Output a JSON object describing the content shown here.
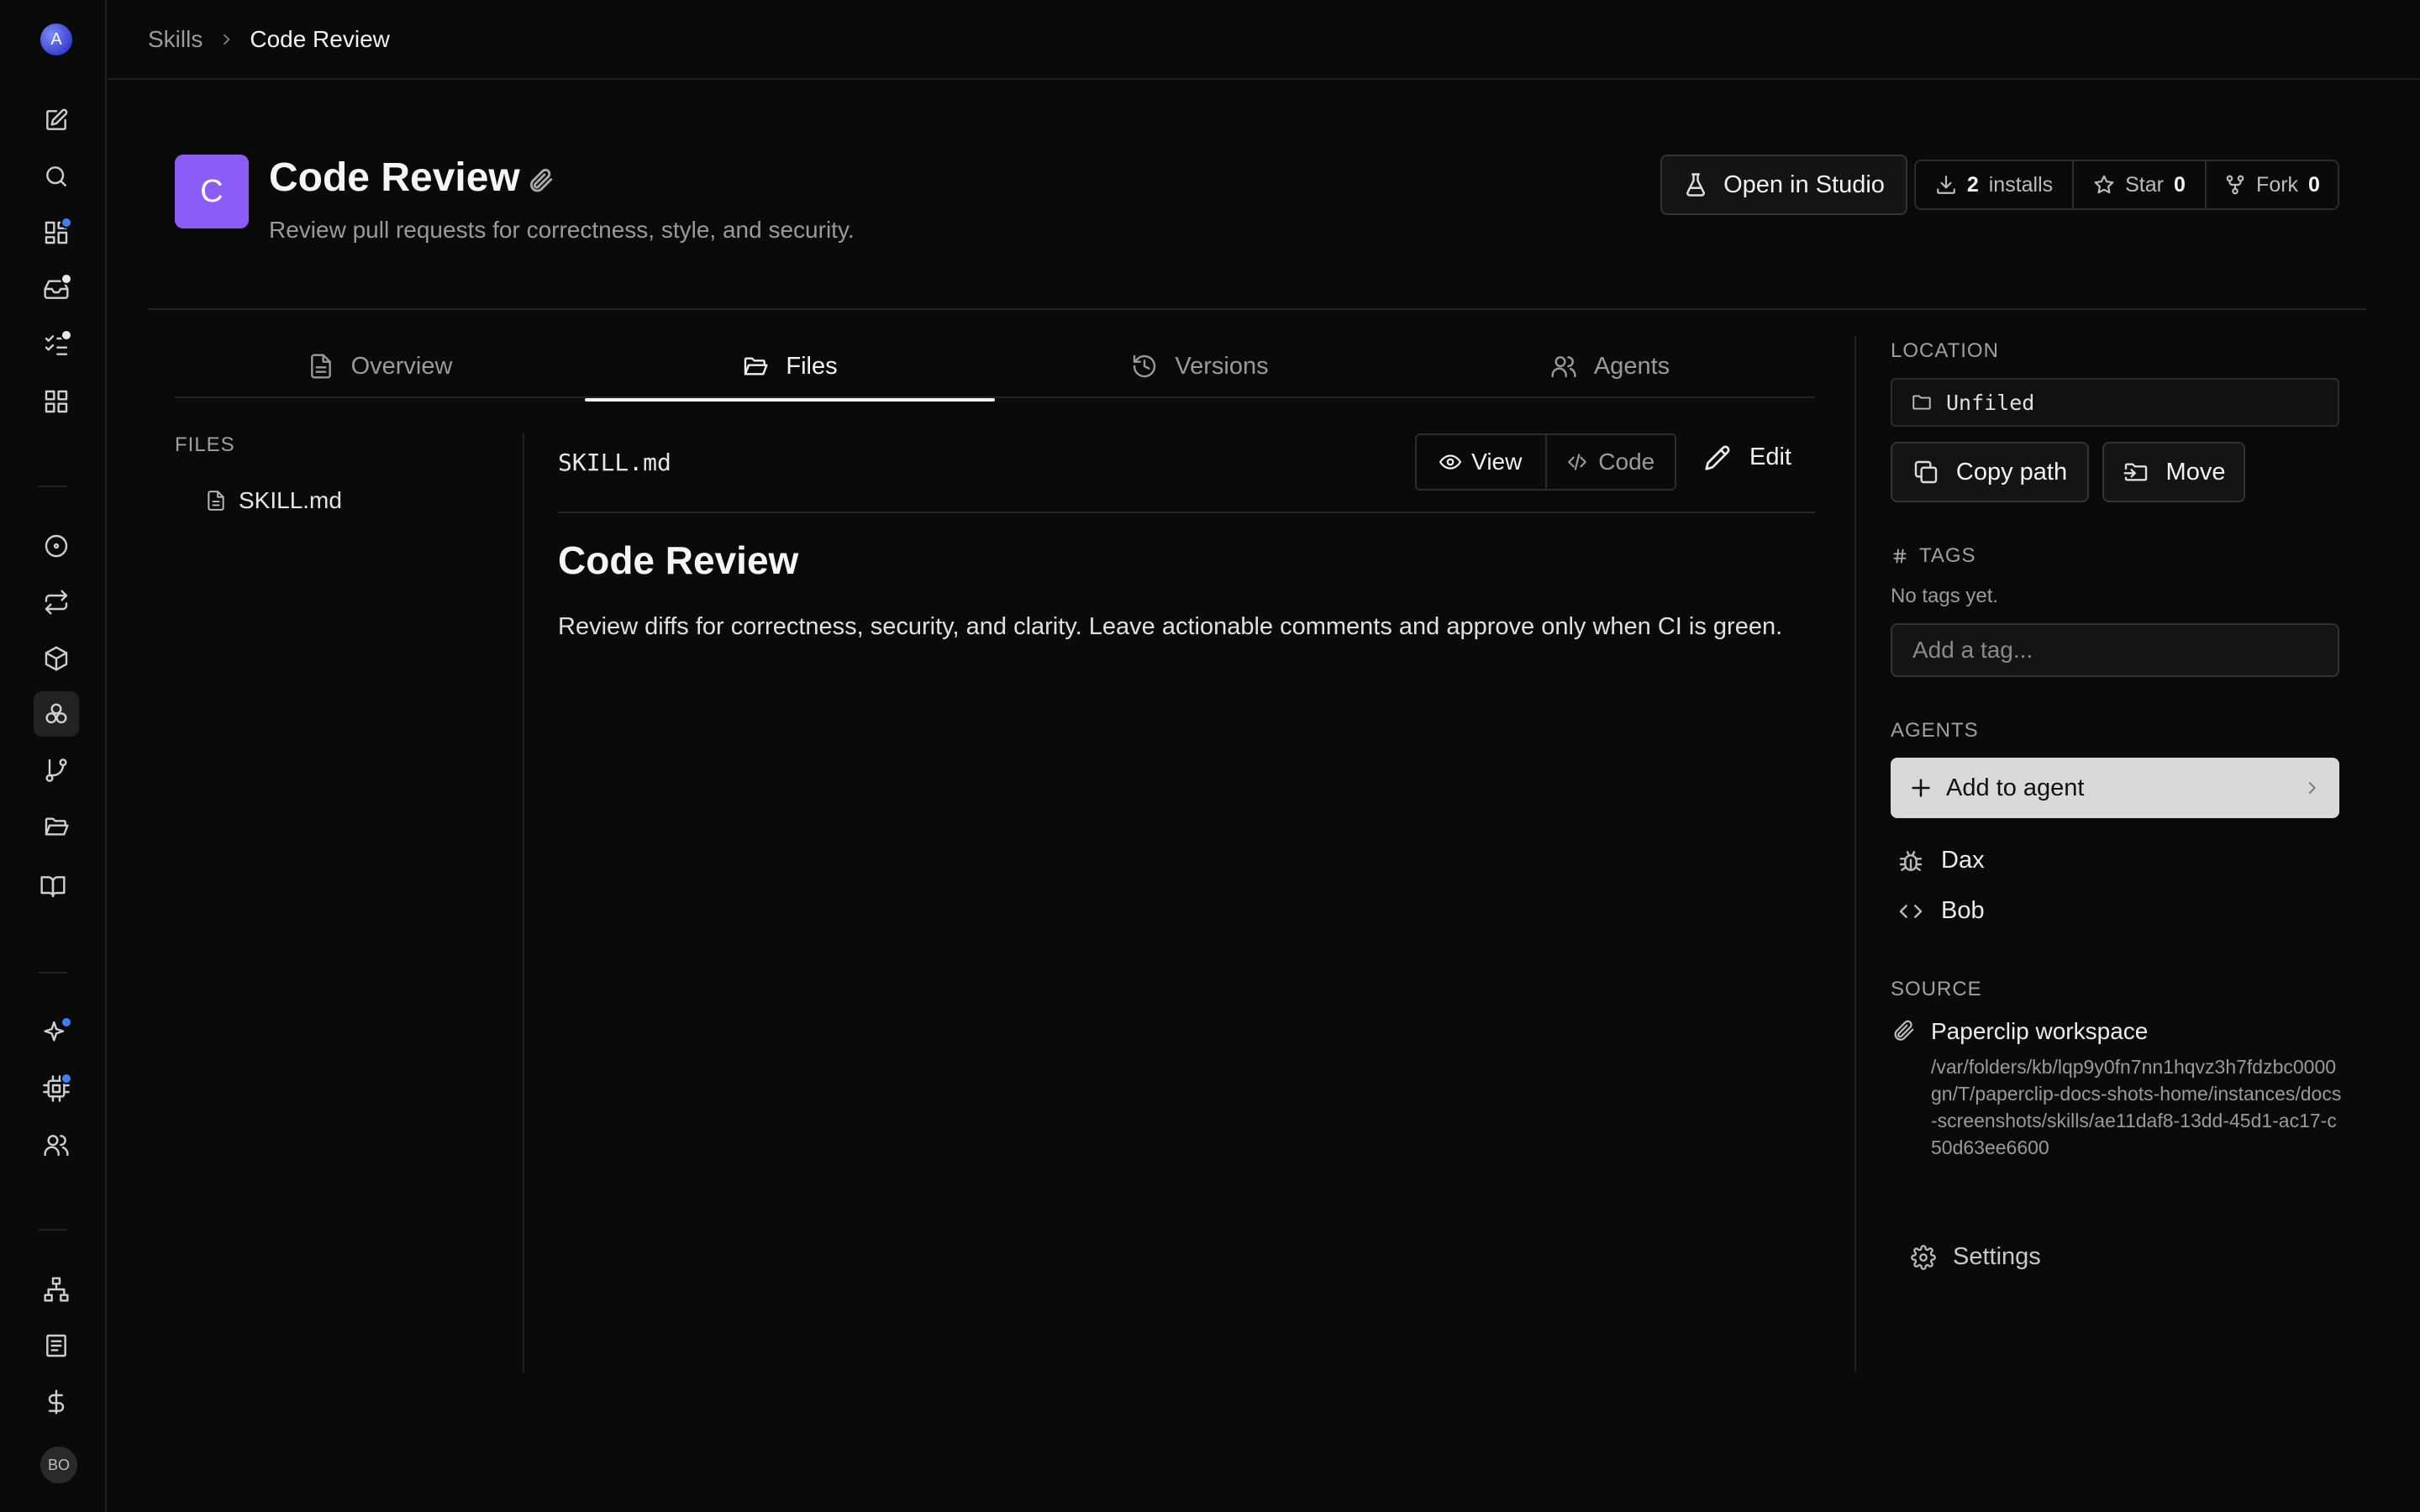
{
  "rail": {
    "logo_letter": "A",
    "user_initials": "BO"
  },
  "breadcrumb": {
    "parent": "Skills",
    "current": "Code Review"
  },
  "skill": {
    "avatar_letter": "C",
    "title": "Code Review",
    "description": "Review pull requests for correctness, style, and security.",
    "accent_color": "#8b5cf6"
  },
  "header_actions": {
    "open_studio": "Open in Studio",
    "installs_count": "2",
    "installs_label": "installs",
    "star_label": "Star",
    "star_count": "0",
    "fork_label": "Fork",
    "fork_count": "0"
  },
  "tabs": [
    {
      "label": "Overview",
      "icon": "document-icon"
    },
    {
      "label": "Files",
      "icon": "folder-open-icon",
      "active": true
    },
    {
      "label": "Versions",
      "icon": "history-icon"
    },
    {
      "label": "Agents",
      "icon": "users-icon"
    }
  ],
  "files": {
    "label": "FILES",
    "items": [
      "SKILL.md"
    ]
  },
  "editor": {
    "file_name": "SKILL.md",
    "view_label": "View",
    "code_label": "Code",
    "edit_label": "Edit",
    "heading": "Code Review",
    "body": "Review diffs for correctness, security, and clarity. Leave actionable comments and approve only when CI is green."
  },
  "panel": {
    "location_label": "LOCATION",
    "location_value": "Unfiled",
    "copy_path": "Copy path",
    "move": "Move",
    "tags_label": "TAGS",
    "no_tags": "No tags yet.",
    "tag_placeholder": "Add a tag...",
    "agents_label": "AGENTS",
    "add_to_agent": "Add to agent",
    "agents": [
      {
        "name": "Dax",
        "icon": "bug-icon"
      },
      {
        "name": "Bob",
        "icon": "code-icon"
      }
    ],
    "source_label": "SOURCE",
    "source_name": "Paperclip workspace",
    "source_path": "/var/folders/kb/lqp9y0fn7nn1hqvz3h7fdzbc0000gn/T/paperclip-docs-shots-home/instances/docs-screenshots/skills/ae11daf8-13dd-45d1-ac17-c50d63ee6600",
    "settings": "Settings"
  }
}
